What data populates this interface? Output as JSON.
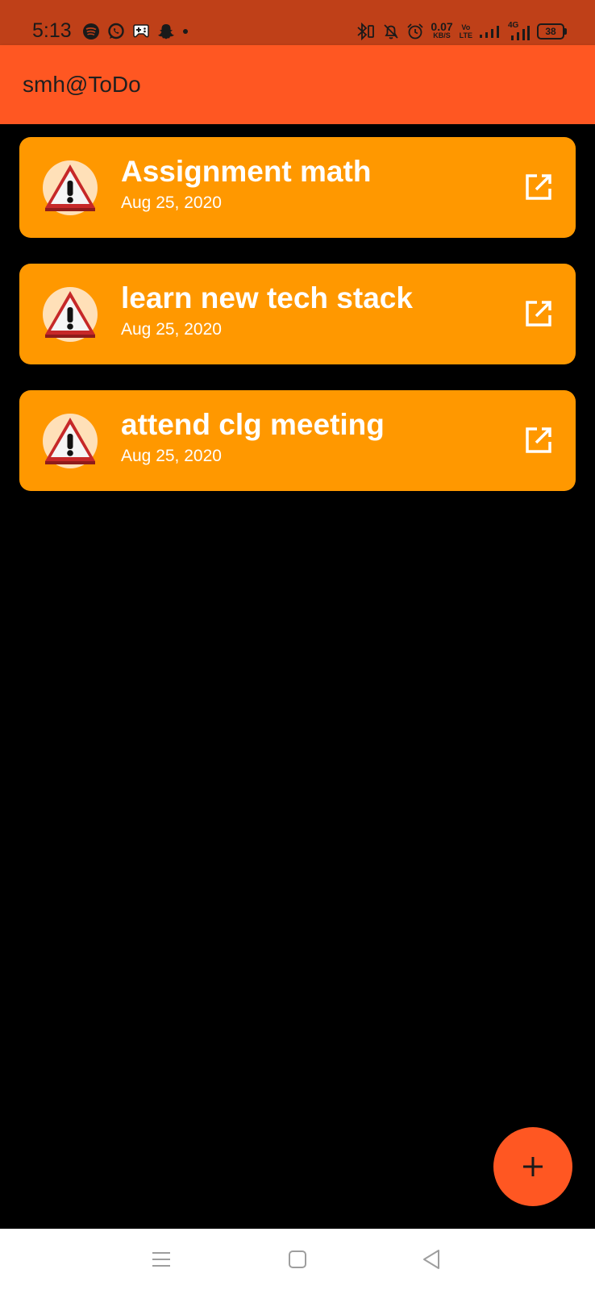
{
  "status_bar": {
    "time": "5:13",
    "net_speed_value": "0.07",
    "net_speed_unit": "KB/S",
    "volte_top": "Vo",
    "volte_bottom": "LTE",
    "network_type": "4G",
    "battery_level": "38",
    "left_icons": [
      "spotify-icon",
      "whatsapp-icon",
      "game-controller-icon",
      "snapchat-icon",
      "dot-icon"
    ],
    "right_icons": [
      "bluetooth-icon",
      "bell-off-icon",
      "alarm-icon",
      "signal-icon",
      "signal-icon"
    ],
    "background_color": "#bf4018"
  },
  "app_bar": {
    "title": "smh@ToDo",
    "background_color": "#ff5722"
  },
  "todos": [
    {
      "title": "Assignment math",
      "date": "Aug 25, 2020",
      "icon": "warning-icon",
      "action_icon": "open-external-icon"
    },
    {
      "title": "learn new tech stack",
      "date": "Aug 25, 2020",
      "icon": "warning-icon",
      "action_icon": "open-external-icon"
    },
    {
      "title": "attend clg meeting",
      "date": "Aug 25, 2020",
      "icon": "warning-icon",
      "action_icon": "open-external-icon"
    }
  ],
  "card_color": "#ff9800",
  "fab": {
    "icon": "plus-icon",
    "color": "#ff5722"
  },
  "nav_bar": {
    "buttons": [
      "menu-icon",
      "home-square-icon",
      "back-triangle-icon"
    ]
  }
}
